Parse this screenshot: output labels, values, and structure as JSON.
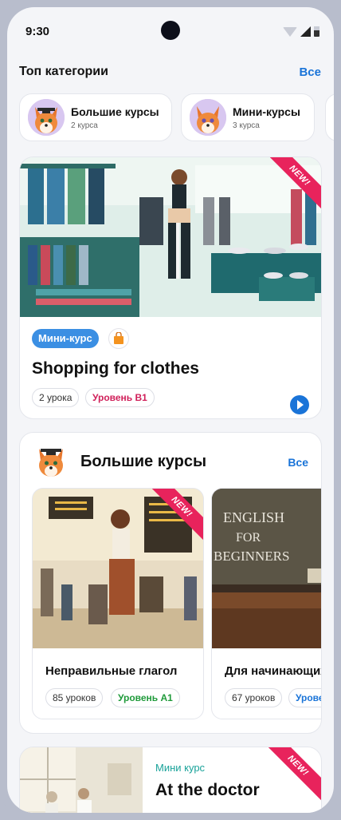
{
  "status": {
    "time": "9:30"
  },
  "top_categories": {
    "title": "Топ категории",
    "all_link": "Все",
    "items": [
      {
        "name": "Большие курсы",
        "count": "2 курса"
      },
      {
        "name": "Мини-курсы",
        "count": "3 курса"
      }
    ]
  },
  "feature": {
    "badge_new": "NEW!",
    "type_pill": "Мини-курс",
    "bag_icon": "shopping-bag-icon",
    "title": "Shopping for clothes",
    "lessons": "2 урока",
    "level": "Уровень B1"
  },
  "big_courses": {
    "title": "Большие курсы",
    "all_link": "Все",
    "courses": [
      {
        "name": "Неправильные глагол",
        "badge_new": "NEW!",
        "lessons": "85 уроков",
        "level": "Уровень A1"
      },
      {
        "name": "Для начинающих",
        "lessons": "67 уроков",
        "level": "Уровень",
        "image_text_1": "ENGLISH",
        "image_text_2": "FOR",
        "image_text_3": "BEGINNERS"
      }
    ]
  },
  "doctor": {
    "badge_new": "NEW!",
    "kicker": "Мини курс",
    "title": "At the doctor"
  },
  "colors": {
    "accent": "#1a74d8",
    "new_badge": "#e8235c",
    "level_red": "#d0205a",
    "level_green": "#1f9a3a",
    "kicker": "#1aa39a"
  }
}
